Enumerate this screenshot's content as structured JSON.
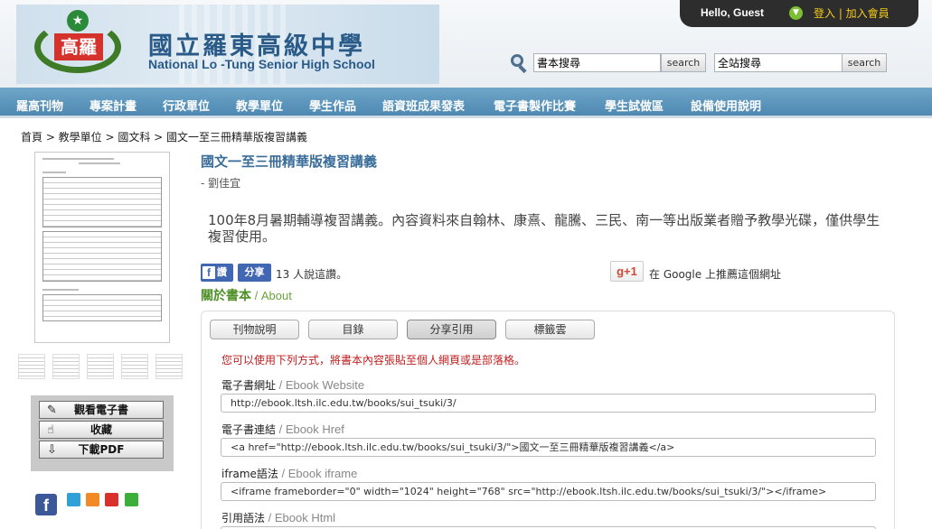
{
  "header": {
    "school_cn": "國立羅東高級中學",
    "school_en": "National Lo -Tung Senior High School",
    "emblem_text": "高羅",
    "greeting": "Hello, Guest",
    "login_text": "登入 | 加入會員",
    "search_book": {
      "value": "書本搜尋",
      "button": "search"
    },
    "search_site": {
      "value": "全站搜尋",
      "button": "search"
    }
  },
  "nav": {
    "items": [
      "羅高刊物",
      "專案計畫",
      "行政單位",
      "教學單位",
      "學生作品",
      "語資班成果發表",
      "電子書製作比賽",
      "學生試做區",
      "設備使用說明"
    ]
  },
  "breadcrumb": "首頁 > 教學單位 > 國文科 > 國文一至三冊精華版複習講義",
  "book": {
    "title": "國文一至三冊精華版複習講義",
    "author": "- 劉佳宜",
    "description": "100年8月暑期輔導複習講義。內容資料來自翰林、康熹、龍騰、三民、南一等出版業者贈予教學光碟，僅供學生複習使用。"
  },
  "actions": {
    "view": "觀看電子書",
    "collect": "收藏",
    "download": "下載PDF"
  },
  "share": {
    "fb_like": "讚",
    "fb_share": "分享",
    "count_text": "13 人說這讚。",
    "gplus": "g+1",
    "gplus_text": "在 Google 上推薦這個網址"
  },
  "about": {
    "label": "關於書本",
    "en": " / About"
  },
  "tabs": [
    "刊物說明",
    "目錄",
    "分享引用",
    "標籤雲"
  ],
  "active_tab": "分享引用",
  "notice": "您可以使用下列方式，將書本內容張貼至個人網頁或是部落格。",
  "fields": [
    {
      "label": "電子書網址",
      "en": " / Ebook Website",
      "value": "http://ebook.ltsh.ilc.edu.tw/books/sui_tsuki/3/"
    },
    {
      "label": "電子書連結",
      "en": " / Ebook Href",
      "value": "<a href=\"http://ebook.ltsh.ilc.edu.tw/books/sui_tsuki/3/\">國文一至三冊精華版複習講義</a>"
    },
    {
      "label": "iframe語法",
      "en": " / Ebook iframe",
      "value": "<iframe frameborder=\"0\" width=\"1024\" height=\"768\" src=\"http://ebook.ltsh.ilc.edu.tw/books/sui_tsuki/3/\"></iframe>"
    },
    {
      "label": "引用語法",
      "en": " / Ebook Html",
      "value": ""
    }
  ],
  "colors": {
    "nav": "#5a93bb",
    "title": "#3a6d9a",
    "about": "#4d8f26",
    "notice": "#c01e1e",
    "login": "#f5c91a"
  }
}
